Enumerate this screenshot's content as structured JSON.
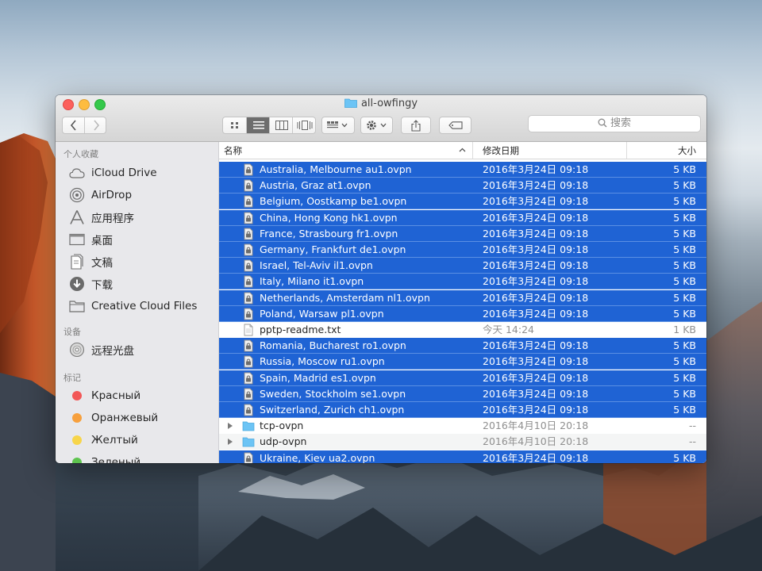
{
  "window": {
    "title": "all-owfingy"
  },
  "search": {
    "placeholder": "搜索"
  },
  "sidebar": {
    "favorites_heading": "个人收藏",
    "favorites": [
      {
        "label": "iCloud Drive",
        "icon": "cloud-icon"
      },
      {
        "label": "AirDrop",
        "icon": "airdrop-icon"
      },
      {
        "label": "应用程序",
        "icon": "applications-icon"
      },
      {
        "label": "桌面",
        "icon": "desktop-icon"
      },
      {
        "label": "文稿",
        "icon": "documents-icon"
      },
      {
        "label": "下载",
        "icon": "downloads-icon"
      },
      {
        "label": "Creative Cloud Files",
        "icon": "folder-icon"
      }
    ],
    "devices_heading": "设备",
    "devices": [
      {
        "label": "远程光盘",
        "icon": "disc-icon"
      }
    ],
    "tags_heading": "标记",
    "tags": [
      {
        "label": "Красный",
        "color": "#f25757"
      },
      {
        "label": "Оранжевый",
        "color": "#f7a03d"
      },
      {
        "label": "Желтый",
        "color": "#f7d54a"
      },
      {
        "label": "Зеленый",
        "color": "#5ec44f"
      }
    ]
  },
  "columns": {
    "name": "名称",
    "date": "修改日期",
    "size": "大小"
  },
  "files": [
    {
      "name": "Australia, Melbourne au1.ovpn",
      "date": "2016年3月24日 09:18",
      "size": "5 KB",
      "selected": true,
      "kind": "ovpn"
    },
    {
      "name": "Austria, Graz at1.ovpn",
      "date": "2016年3月24日 09:18",
      "size": "5 KB",
      "selected": true,
      "kind": "ovpn"
    },
    {
      "name": "Belgium, Oostkamp be1.ovpn",
      "date": "2016年3月24日 09:18",
      "size": "5 KB",
      "selected": true,
      "kind": "ovpn"
    },
    {
      "name": "China, Hong Kong hk1.ovpn",
      "date": "2016年3月24日 09:18",
      "size": "5 KB",
      "selected": true,
      "kind": "ovpn"
    },
    {
      "name": "France, Strasbourg fr1.ovpn",
      "date": "2016年3月24日 09:18",
      "size": "5 KB",
      "selected": true,
      "kind": "ovpn"
    },
    {
      "name": "Germany, Frankfurt de1.ovpn",
      "date": "2016年3月24日 09:18",
      "size": "5 KB",
      "selected": true,
      "kind": "ovpn"
    },
    {
      "name": "Israel, Tel-Aviv il1.ovpn",
      "date": "2016年3月24日 09:18",
      "size": "5 KB",
      "selected": true,
      "kind": "ovpn"
    },
    {
      "name": "Italy, Milano it1.ovpn",
      "date": "2016年3月24日 09:18",
      "size": "5 KB",
      "selected": true,
      "kind": "ovpn"
    },
    {
      "name": "Netherlands, Amsterdam nl1.ovpn",
      "date": "2016年3月24日 09:18",
      "size": "5 KB",
      "selected": true,
      "kind": "ovpn"
    },
    {
      "name": "Poland, Warsaw pl1.ovpn",
      "date": "2016年3月24日 09:18",
      "size": "5 KB",
      "selected": true,
      "kind": "ovpn"
    },
    {
      "name": "pptp-readme.txt",
      "date": "今天 14:24",
      "size": "1 KB",
      "selected": false,
      "kind": "txt"
    },
    {
      "name": "Romania, Bucharest ro1.ovpn",
      "date": "2016年3月24日 09:18",
      "size": "5 KB",
      "selected": true,
      "kind": "ovpn"
    },
    {
      "name": "Russia, Moscow ru1.ovpn",
      "date": "2016年3月24日 09:18",
      "size": "5 KB",
      "selected": true,
      "kind": "ovpn"
    },
    {
      "name": "Spain, Madrid es1.ovpn",
      "date": "2016年3月24日 09:18",
      "size": "5 KB",
      "selected": true,
      "kind": "ovpn"
    },
    {
      "name": "Sweden, Stockholm se1.ovpn",
      "date": "2016年3月24日 09:18",
      "size": "5 KB",
      "selected": true,
      "kind": "ovpn"
    },
    {
      "name": "Switzerland, Zurich ch1.ovpn",
      "date": "2016年3月24日 09:18",
      "size": "5 KB",
      "selected": true,
      "kind": "ovpn"
    },
    {
      "name": "tcp-ovpn",
      "date": "2016年4月10日 20:18",
      "size": "--",
      "selected": false,
      "kind": "folder"
    },
    {
      "name": "udp-ovpn",
      "date": "2016年4月10日 20:18",
      "size": "--",
      "selected": false,
      "kind": "folder"
    },
    {
      "name": "Ukraine, Kiev ua2.ovpn",
      "date": "2016年3月24日 09:18",
      "size": "5 KB",
      "selected": true,
      "kind": "ovpn"
    }
  ],
  "colors": {
    "selection": "#1f63d4",
    "folder": "#6cc4f5"
  }
}
